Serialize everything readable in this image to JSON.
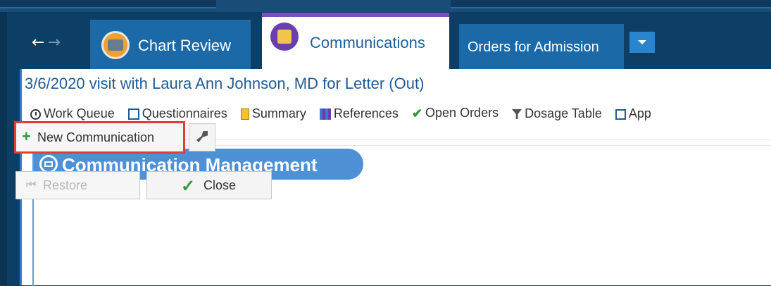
{
  "nav": {
    "back_label": "←",
    "forward_label": "→"
  },
  "tabs": [
    {
      "label": "Chart Review",
      "icon": "chart-review-icon"
    },
    {
      "label": "Communications",
      "icon": "communications-icon",
      "active": true
    },
    {
      "label": "Orders for Admission"
    }
  ],
  "tab_more_icon": "dropdown-arrow-icon",
  "visit_title": "3/6/2020 visit with Laura Ann Johnson, MD for Letter (Out)",
  "toolbar": [
    {
      "label": "Work Queue",
      "icon": "clock-icon"
    },
    {
      "label": "Questionnaires",
      "icon": "questionnaire-icon"
    },
    {
      "label": "Summary",
      "icon": "summary-icon"
    },
    {
      "label": "References",
      "icon": "references-icon"
    },
    {
      "label": "Open Orders",
      "icon": "open-orders-icon"
    },
    {
      "label": "Dosage Table",
      "icon": "dosage-icon"
    },
    {
      "label": "App",
      "icon": "app-icon"
    }
  ],
  "module": {
    "title": "Communication Management",
    "icon": "envelope-icon",
    "new_label": "New Communication",
    "restore_label": "Restore",
    "close_label": "Close"
  },
  "colors": {
    "background": "#0d3f66",
    "tab_inactive": "#1b6aa7",
    "tab_active_accent": "#7a4fbf",
    "header_blue": "#4e90d6",
    "highlight_red": "#e33b3b",
    "success_green": "#2e9a3a"
  }
}
